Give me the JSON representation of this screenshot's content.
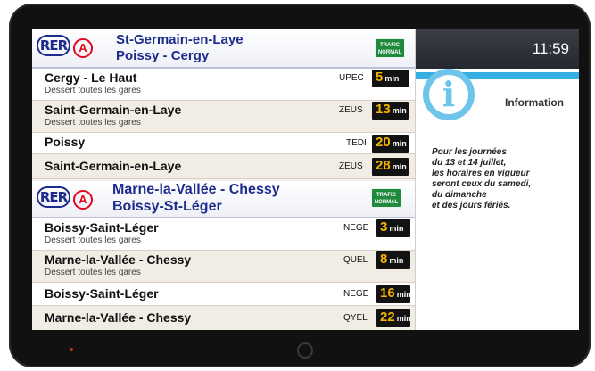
{
  "line1": {
    "network": "RER",
    "line": "A",
    "destination_1": "St-Germain-en-Laye",
    "destination_2": "Poissy - Cergy",
    "status_line1": "TRAFIC",
    "status_line2": "NORMAL",
    "departures": [
      {
        "destination": "Cergy - Le Haut",
        "note": "Dessert toutes les gares",
        "code": "UPEC",
        "minutes": "5",
        "unit": "min"
      },
      {
        "destination": "Saint-Germain-en-Laye",
        "note": "Dessert toutes les gares",
        "code": "ZEUS",
        "minutes": "13",
        "unit": "min"
      },
      {
        "destination": "Poissy",
        "note": "",
        "code": "TEDI",
        "minutes": "20",
        "unit": "min"
      },
      {
        "destination": "Saint-Germain-en-Laye",
        "note": "",
        "code": "ZEUS",
        "minutes": "28",
        "unit": "min"
      }
    ]
  },
  "line2": {
    "network": "RER",
    "line": "A",
    "destination_1": "Marne-la-Vallée - Chessy",
    "destination_2": "Boissy-St-Léger",
    "status_line1": "TRAFIC",
    "status_line2": "NORMAL",
    "departures": [
      {
        "destination": "Boissy-Saint-Léger",
        "note": "Dessert toutes les gares",
        "code": "NEGE",
        "minutes": "3",
        "unit": "min"
      },
      {
        "destination": "Marne-la-Vallée - Chessy",
        "note": "Dessert toutes les gares",
        "code": "QUEL",
        "minutes": "8",
        "unit": "min"
      },
      {
        "destination": "Boissy-Saint-Léger",
        "note": "",
        "code": "NEGE",
        "minutes": "16",
        "unit": "min"
      },
      {
        "destination": "Marne-la-Vallée - Chessy",
        "note": "",
        "code": "QYEL",
        "minutes": "22",
        "unit": "min"
      }
    ]
  },
  "side": {
    "clock": "11:59",
    "info_icon_glyph": "i",
    "info_title": "Information",
    "message_lines": [
      "Pour les journées",
      "du 13 et 14 juillet,",
      "les horaires en vigueur",
      "seront ceux du samedi,",
      "du dimanche",
      "et des jours fériés."
    ]
  },
  "colors": {
    "rer_blue": "#1d2c8c",
    "line_a_red": "#e3051b",
    "trafic_green": "#1f8a3c",
    "minutes_yellow": "#f2b400",
    "info_blue": "#33aee0"
  }
}
